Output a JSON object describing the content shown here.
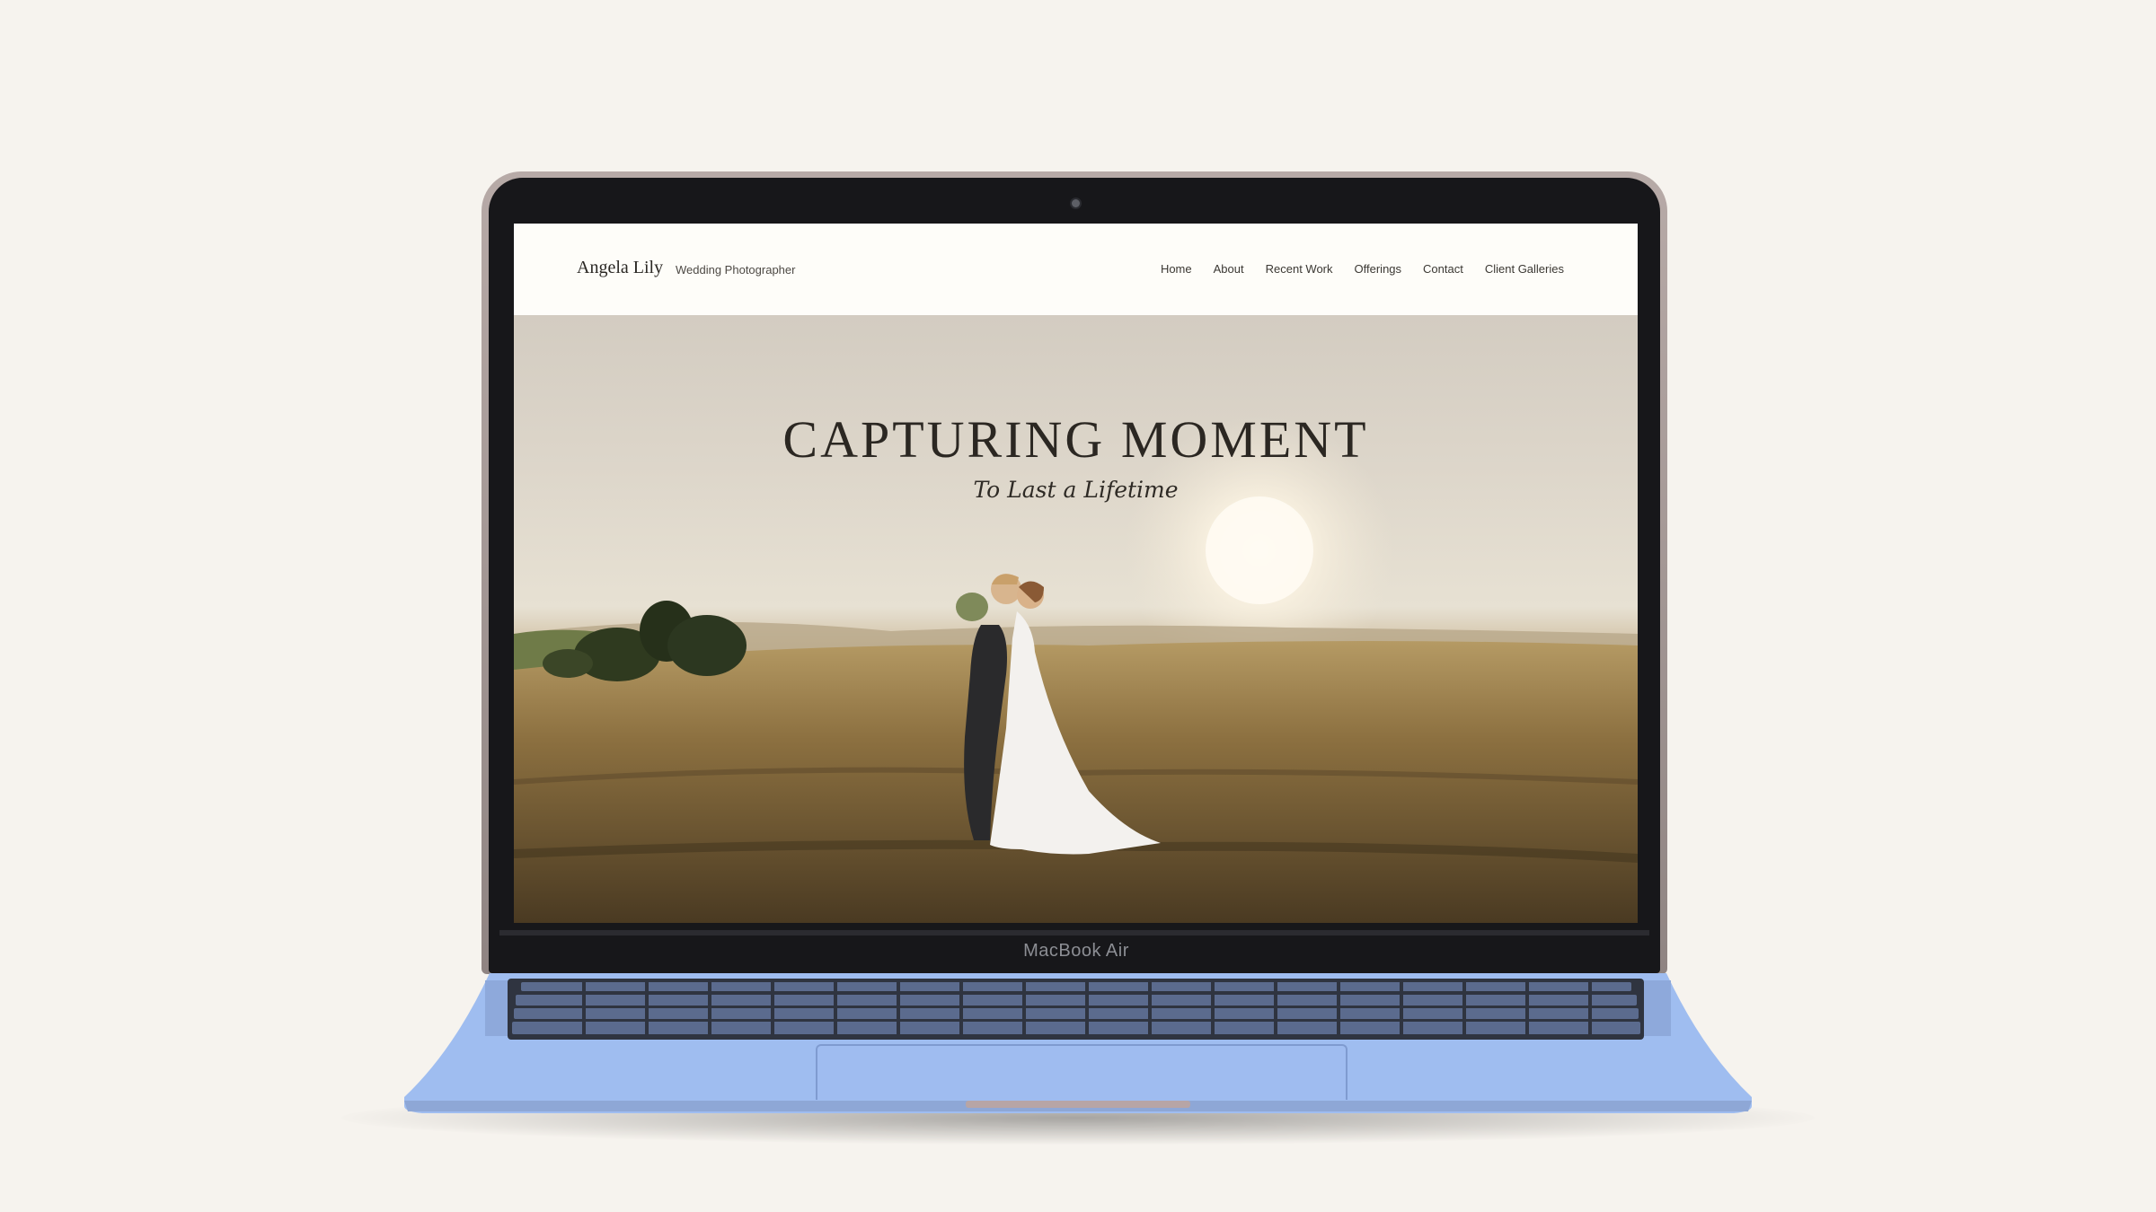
{
  "device": {
    "brand_label": "MacBook Air"
  },
  "site": {
    "title": "Angela Lily",
    "tagline": "Wedding Photographer",
    "nav": [
      {
        "label": "Home"
      },
      {
        "label": "About"
      },
      {
        "label": "Recent Work"
      },
      {
        "label": "Offerings"
      },
      {
        "label": "Contact"
      },
      {
        "label": "Client Galleries"
      }
    ],
    "hero": {
      "heading": "CAPTURING MOMENT",
      "subheading": "To Last a Lifetime"
    }
  },
  "colors": {
    "page_background": "#f6f3ee",
    "laptop_base": "#9fbdf0",
    "bezel": "#17171a",
    "header_background": "#fefdf9"
  }
}
